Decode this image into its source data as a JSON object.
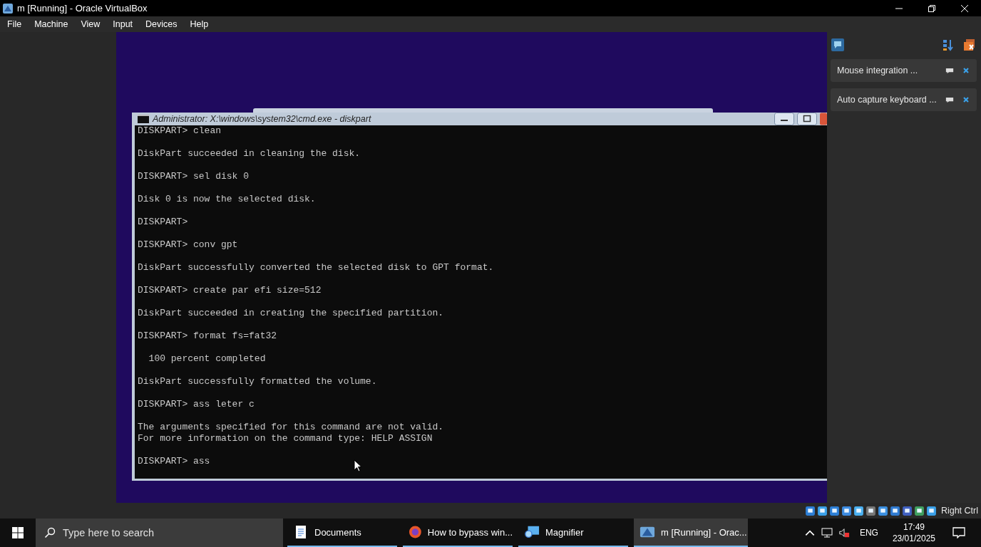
{
  "window": {
    "title": "m [Running] - Oracle VirtualBox"
  },
  "menu": [
    "File",
    "Machine",
    "View",
    "Input",
    "Devices",
    "Help"
  ],
  "console": {
    "title": "Administrator: X:\\windows\\system32\\cmd.exe - diskpart",
    "blocks": [
      [
        "DISKPART> clean"
      ],
      [
        "DiskPart succeeded in cleaning the disk."
      ],
      [
        "DISKPART> sel disk 0"
      ],
      [
        "Disk 0 is now the selected disk."
      ],
      [
        "DISKPART>"
      ],
      [
        "DISKPART> conv gpt"
      ],
      [
        "DiskPart successfully converted the selected disk to GPT format."
      ],
      [
        "DISKPART> create par efi size=512"
      ],
      [
        "DiskPart succeeded in creating the specified partition."
      ],
      [
        "DISKPART> format fs=fat32"
      ],
      [
        "  100 percent completed"
      ],
      [
        "DiskPart successfully formatted the volume."
      ],
      [
        "DISKPART> ass leter c"
      ],
      [
        "The arguments specified for this command are not valid.",
        "For more information on the command type: HELP ASSIGN"
      ],
      [
        "DISKPART> ass"
      ]
    ]
  },
  "notifications": [
    "Mouse integration ...",
    "Auto capture keyboard ..."
  ],
  "status_bar": {
    "host_key": "Right Ctrl"
  },
  "taskbar": {
    "search": {
      "placeholder": "Type here to search"
    },
    "apps": [
      {
        "label": "Documents",
        "kind": "documents",
        "selected": false
      },
      {
        "label": "How to bypass win...",
        "kind": "browser",
        "selected": false
      },
      {
        "label": "Magnifier",
        "kind": "magnifier",
        "selected": false
      },
      {
        "label": "m [Running] - Orac...",
        "kind": "virtualbox",
        "selected": true
      }
    ],
    "language": "ENG",
    "time": "17:49",
    "date": "23/01/2025"
  }
}
